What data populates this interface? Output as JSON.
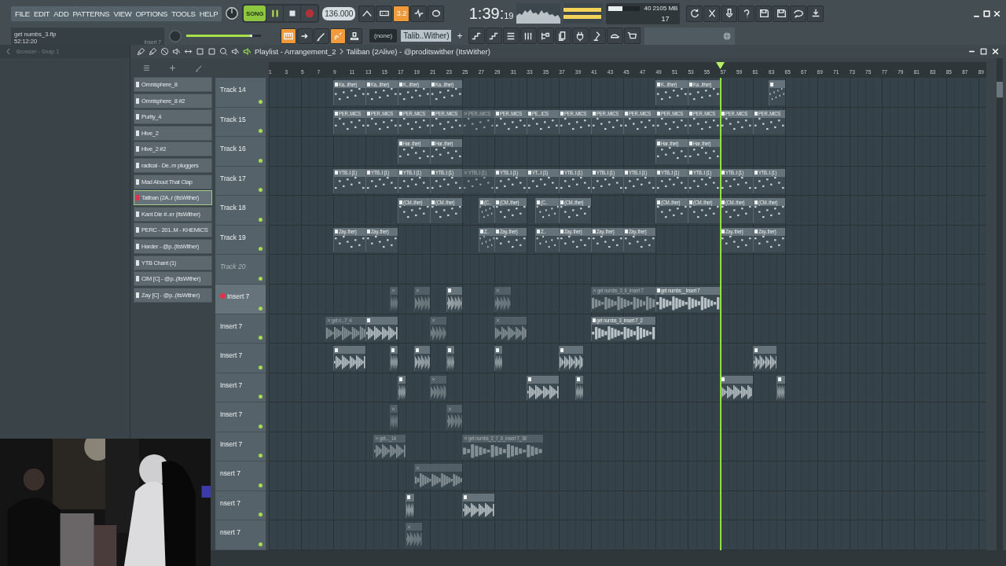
{
  "menu": [
    "FILE",
    "EDIT",
    "ADD",
    "PATTERNS",
    "VIEW",
    "OPTIONS",
    "TOOLS",
    "HELP"
  ],
  "project": {
    "file": "get numbs_3.flp",
    "time": "52:12:20",
    "target": "Insert 7"
  },
  "transport": {
    "mode": "SONG",
    "song_mode": true,
    "playing": true,
    "recording": false,
    "tempo": "136.000"
  },
  "toggles": [
    {
      "on": false
    },
    {
      "on": false
    },
    {
      "on": true,
      "label": "3.2"
    },
    {
      "on": false
    },
    {
      "on": false
    }
  ],
  "clock": {
    "time": "1:39:",
    "subtime": "19"
  },
  "cpu": {
    "level": 0.45,
    "cpu": "40",
    "memory": "2105 MB",
    "polyphony": "17"
  },
  "master_volume": {
    "level": 0.88
  },
  "tools": [
    {
      "on": true
    },
    {
      "on": false
    },
    {
      "on": false
    },
    {
      "on": true
    },
    {
      "on": false
    }
  ],
  "pattern_picker": {
    "value": "(none)",
    "pattern": "Talib..Wither)",
    "add": "+"
  },
  "browser": {
    "title": "Browser - Snap 1"
  },
  "playlist": {
    "title": "Playlist - Arrangement_2",
    "pattern": "Taliban (2Alive) - @proditswither (ItsWither)"
  },
  "channels": [
    {
      "name": "Omnisphere_8",
      "selected": false
    },
    {
      "name": "Omnisphere_8 #2",
      "selected": false
    },
    {
      "name": "Purity_4",
      "selected": false
    },
    {
      "name": "Hive_2",
      "selected": false
    },
    {
      "name": "Hive_2 #2",
      "selected": false
    },
    {
      "name": "radical - De..m pluggers",
      "selected": false
    },
    {
      "name": "Mad About That Clap",
      "selected": false
    },
    {
      "name": "Taliban (2A..r (ItsWither)",
      "selected": true
    },
    {
      "name": "Kant Die #..er (ItsWither)",
      "selected": false
    },
    {
      "name": "PERC - 201..M - KHEMICS",
      "selected": false
    },
    {
      "name": "Harder - @p..(ItsWither)",
      "selected": false
    },
    {
      "name": "YTB Chant (1)",
      "selected": false
    },
    {
      "name": "CIM [C] - @p..(ItsWither)",
      "selected": false
    },
    {
      "name": "Zay [C] - @p..(ItsWither)",
      "selected": false
    }
  ],
  "ruler": [
    "1",
    "3",
    "5",
    "7",
    "9",
    "11",
    "13",
    "15",
    "17",
    "19",
    "21",
    "23",
    "25",
    "27",
    "29",
    "31",
    "33",
    "35",
    "37",
    "39",
    "41",
    "43",
    "45",
    "47",
    "49",
    "51",
    "53",
    "55",
    "57",
    "59",
    "61",
    "63",
    "65",
    "67",
    "69",
    "71",
    "73",
    "75",
    "77",
    "79",
    "81",
    "83",
    "85",
    "87",
    "89"
  ],
  "tracks": [
    {
      "name": "Track 14",
      "enabled": true,
      "selected": false,
      "clips": [
        {
          "kind": "pattern",
          "label": "Ka...ither)",
          "muted": false
        },
        {
          "kind": "pattern",
          "label": "Ka...ither)",
          "muted": false
        },
        {
          "kind": "pattern",
          "label": "K...ither)",
          "muted": false
        },
        {
          "kind": "pattern",
          "label": "Ka...ither)",
          "muted": false
        },
        {
          "kind": "pattern",
          "label": "K...ither)",
          "muted": false
        },
        {
          "kind": "pattern",
          "label": "Ka...ither)",
          "muted": false
        },
        {
          "kind": "pattern",
          "muted": false
        }
      ]
    },
    {
      "name": "Track 15",
      "enabled": true,
      "selected": false,
      "clips": [
        {
          "kind": "pattern",
          "label": "PER..MICS",
          "muted": false
        },
        {
          "kind": "pattern",
          "label": "PER..MICS",
          "muted": false
        },
        {
          "kind": "pattern",
          "label": "PER..MICS",
          "muted": false
        },
        {
          "kind": "pattern",
          "label": "PER..MICS",
          "muted": false
        },
        {
          "kind": "pattern",
          "label": "PER..MICS",
          "muted": true
        },
        {
          "kind": "pattern",
          "label": "PER..MICS",
          "muted": false
        },
        {
          "kind": "pattern",
          "label": "PE...ICS",
          "muted": false
        },
        {
          "kind": "pattern",
          "label": "PER..MICS",
          "muted": false
        },
        {
          "kind": "pattern",
          "label": "PER..MICS",
          "muted": false
        },
        {
          "kind": "pattern",
          "label": "PER..MICS",
          "muted": false
        },
        {
          "kind": "pattern",
          "label": "PER..MICS",
          "muted": false
        },
        {
          "kind": "pattern",
          "label": "PER..MICS",
          "muted": false
        },
        {
          "kind": "pattern",
          "label": "PER..MICS",
          "muted": false
        },
        {
          "kind": "pattern",
          "label": "PER..MICS",
          "muted": false
        }
      ]
    },
    {
      "name": "Track 16",
      "enabled": true,
      "selected": false,
      "clips": [
        {
          "kind": "pattern",
          "label": "Har..ther)",
          "muted": false
        },
        {
          "kind": "pattern",
          "label": "Har..ther)",
          "muted": false
        },
        {
          "kind": "pattern",
          "label": "Har..ther)",
          "muted": false
        },
        {
          "kind": "pattern",
          "label": "Har..ther)",
          "muted": false
        }
      ]
    },
    {
      "name": "Track 17",
      "enabled": true,
      "selected": false,
      "clips": [
        {
          "kind": "pattern",
          "label": "YTB..t (1)",
          "muted": false
        },
        {
          "kind": "pattern",
          "label": "YTB..t (1)",
          "muted": false
        },
        {
          "kind": "pattern",
          "label": "YTB..t (1)",
          "muted": false
        },
        {
          "kind": "pattern",
          "label": "YTB..t (1)",
          "muted": false
        },
        {
          "kind": "pattern",
          "label": "YTB..t (1)",
          "muted": true
        },
        {
          "kind": "pattern",
          "label": "YTB..t (1)",
          "muted": false
        },
        {
          "kind": "pattern",
          "label": "YT...t (1)",
          "muted": false
        },
        {
          "kind": "pattern",
          "label": "YTB..t (1)",
          "muted": false
        },
        {
          "kind": "pattern",
          "label": "YTB..t (1)",
          "muted": false
        },
        {
          "kind": "pattern",
          "label": "YTB..t (1)",
          "muted": false
        },
        {
          "kind": "pattern",
          "label": "YTB..t (1)",
          "muted": false
        },
        {
          "kind": "pattern",
          "label": "YTB..t (1)",
          "muted": false
        },
        {
          "kind": "pattern",
          "label": "YTB..t (1)",
          "muted": false
        },
        {
          "kind": "pattern",
          "label": "YTB..t (1)",
          "muted": false
        }
      ]
    },
    {
      "name": "Track 18",
      "enabled": true,
      "selected": false,
      "clips": [
        {
          "kind": "pattern",
          "label": "(CM..ther)",
          "muted": false
        },
        {
          "kind": "pattern",
          "label": "(CM..ther)",
          "muted": false
        },
        {
          "kind": "pattern",
          "label": "(C..",
          "muted": false
        },
        {
          "kind": "pattern",
          "label": "(CM..ther)",
          "muted": false
        },
        {
          "kind": "pattern",
          "label": "(C..",
          "muted": false
        },
        {
          "kind": "pattern",
          "label": "(CM..ther)",
          "muted": false
        },
        {
          "kind": "pattern",
          "label": "(CM..ther)",
          "muted": false
        },
        {
          "kind": "pattern",
          "label": "(CM..ther)",
          "muted": false
        },
        {
          "kind": "pattern",
          "label": "(CM..ther)",
          "muted": false
        },
        {
          "kind": "pattern",
          "label": "(CM..ther)",
          "muted": false
        }
      ]
    },
    {
      "name": "Track 19",
      "enabled": true,
      "selected": false,
      "clips": [
        {
          "kind": "pattern",
          "label": "Zay..ther)",
          "muted": false
        },
        {
          "kind": "pattern",
          "label": "Zay..ther)",
          "muted": false
        },
        {
          "kind": "pattern",
          "label": "Z..",
          "muted": false
        },
        {
          "kind": "pattern",
          "label": "Zay..ther)",
          "muted": false
        },
        {
          "kind": "pattern",
          "label": "Z..",
          "muted": false
        },
        {
          "kind": "pattern",
          "label": "Zay..ther)",
          "muted": false
        },
        {
          "kind": "pattern",
          "label": "Zay..ther)",
          "muted": false
        },
        {
          "kind": "pattern",
          "label": "Zay..ther)",
          "muted": false
        },
        {
          "kind": "pattern",
          "label": "Zay..ther)",
          "muted": false
        },
        {
          "kind": "pattern",
          "label": "Zay..ther)",
          "muted": false
        }
      ]
    },
    {
      "name": "Track 20",
      "enabled": false,
      "selected": false
    },
    {
      "name": "Insert 7",
      "enabled": true,
      "selected": true,
      "clips": [
        {
          "kind": "audio",
          "muted": true
        },
        {
          "kind": "audio",
          "muted": true
        },
        {
          "kind": "audio",
          "muted": false
        },
        {
          "kind": "audio",
          "muted": true
        },
        {
          "kind": "audio",
          "label": "get numbs_3_6_Insert 7",
          "muted": true
        },
        {
          "kind": "audio",
          "label": "get numbs__Insert 7",
          "muted": false
        }
      ]
    },
    {
      "name": "Insert 7",
      "enabled": true,
      "selected": false,
      "clips": [
        {
          "kind": "audio",
          "label": "get n...7_4",
          "muted": true
        },
        {
          "kind": "audio",
          "muted": false
        },
        {
          "kind": "audio",
          "muted": true
        },
        {
          "kind": "audio",
          "muted": true
        },
        {
          "kind": "audio",
          "label": "get numbs_3_Insert 7_2",
          "muted": false
        }
      ]
    },
    {
      "name": "Insert 7",
      "enabled": true,
      "selected": false,
      "clips": [
        {
          "kind": "audio",
          "muted": false
        },
        {
          "kind": "audio",
          "muted": false
        },
        {
          "kind": "audio",
          "muted": false
        },
        {
          "kind": "audio",
          "muted": false
        },
        {
          "kind": "audio",
          "muted": false
        },
        {
          "kind": "audio",
          "muted": false
        },
        {
          "kind": "audio",
          "muted": false
        }
      ]
    },
    {
      "name": "Insert 7",
      "enabled": true,
      "selected": false,
      "clips": [
        {
          "kind": "audio",
          "muted": false
        },
        {
          "kind": "audio",
          "muted": true
        },
        {
          "kind": "audio",
          "muted": false
        },
        {
          "kind": "audio",
          "muted": false
        },
        {
          "kind": "audio",
          "muted": false
        },
        {
          "kind": "audio",
          "muted": false
        }
      ]
    },
    {
      "name": "Insert 7",
      "enabled": true,
      "selected": false,
      "clips": [
        {
          "kind": "audio",
          "muted": true
        },
        {
          "kind": "audio",
          "muted": true
        }
      ]
    },
    {
      "name": "Insert 7",
      "enabled": true,
      "selected": false,
      "clips": [
        {
          "kind": "audio",
          "label": "get..._14",
          "muted": true
        },
        {
          "kind": "audio",
          "label": "get numbs_2_7_6_Insert 7_38",
          "muted": true
        }
      ]
    },
    {
      "name": "nsert 7",
      "enabled": true,
      "selected": false,
      "clips": [
        {
          "kind": "audio",
          "muted": true
        }
      ]
    },
    {
      "name": "nsert 7",
      "enabled": true,
      "selected": false,
      "clips": [
        {
          "kind": "audio",
          "muted": false
        },
        {
          "kind": "audio",
          "muted": false
        }
      ]
    },
    {
      "name": "nsert 7",
      "enabled": true,
      "selected": false,
      "clips": [
        {
          "kind": "audio",
          "muted": true
        }
      ]
    }
  ]
}
